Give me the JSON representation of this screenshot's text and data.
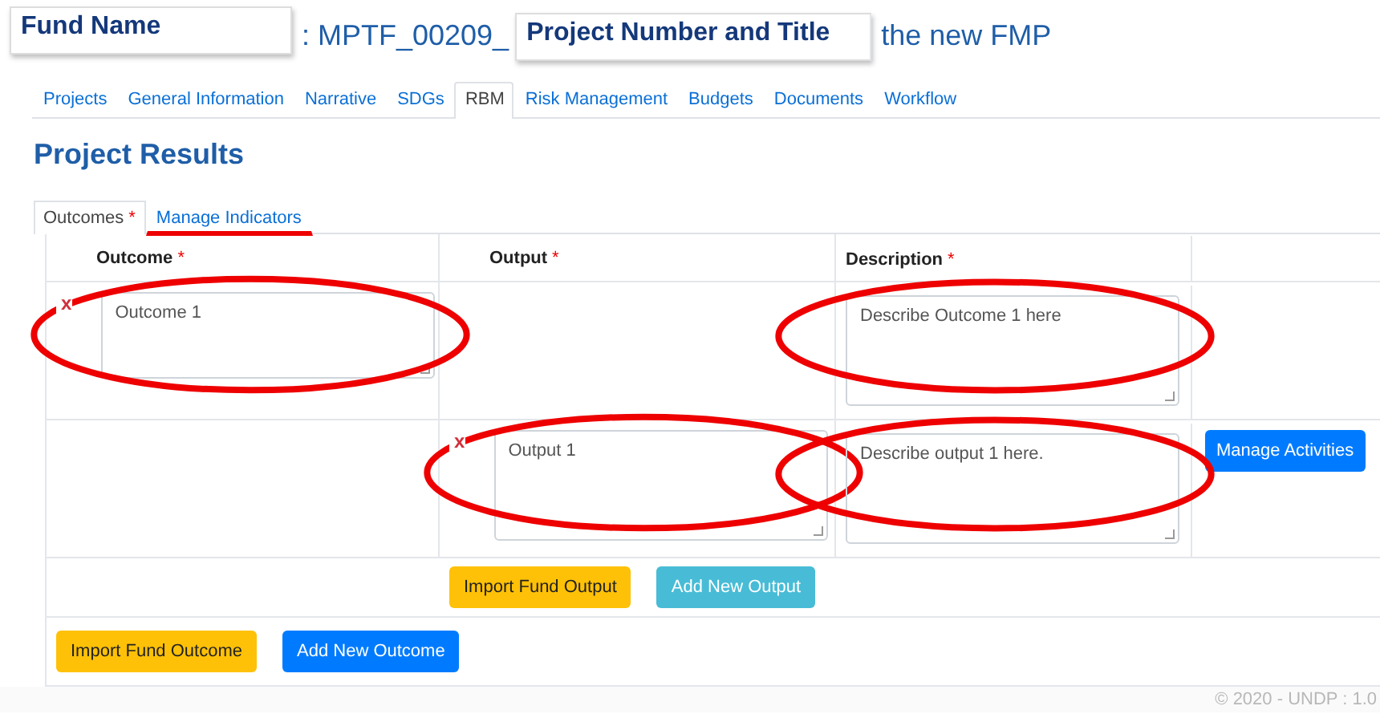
{
  "title": {
    "fund_label": "Fund Name",
    "prefix": ": MPTF_00209_",
    "project_label": "Project Number and Title",
    "suffix": "the new FMP"
  },
  "tabs": [
    {
      "label": "Projects",
      "selected": false
    },
    {
      "label": "General Information",
      "selected": false
    },
    {
      "label": "Narrative",
      "selected": false
    },
    {
      "label": "SDGs",
      "selected": false
    },
    {
      "label": "RBM",
      "selected": true
    },
    {
      "label": "Risk Management",
      "selected": false
    },
    {
      "label": "Budgets",
      "selected": false
    },
    {
      "label": "Documents",
      "selected": false
    },
    {
      "label": "Workflow",
      "selected": false
    }
  ],
  "heading": "Project Results",
  "subtabs": [
    {
      "label": "Outcomes",
      "required": true,
      "selected": true,
      "underlined": false
    },
    {
      "label": "Manage Indicators",
      "required": false,
      "selected": false,
      "underlined": true
    }
  ],
  "table": {
    "columns": [
      {
        "label": "Outcome",
        "required": true
      },
      {
        "label": "Output",
        "required": true
      },
      {
        "label": "Description",
        "required": true
      }
    ],
    "rows": [
      {
        "kind": "outcome",
        "remove": "x",
        "value": "Outcome 1",
        "circled": true,
        "description": "Describe Outcome 1 here",
        "description_circled": true
      },
      {
        "kind": "output",
        "remove": "x",
        "value": "Output 1",
        "circled": true,
        "description": "Describe output 1 here.",
        "description_circled": true,
        "action": "Manage Activities"
      }
    ],
    "output_buttons": [
      {
        "label": "Import Fund Output",
        "kind": "warning"
      },
      {
        "label": "Add New Output",
        "kind": "info"
      }
    ],
    "outcome_buttons": [
      {
        "label": "Import Fund Outcome",
        "kind": "warning"
      },
      {
        "label": "Add New Outcome",
        "kind": "primary"
      }
    ]
  },
  "required_marker": "*",
  "footer": "© 2020 - UNDP : 1.0"
}
